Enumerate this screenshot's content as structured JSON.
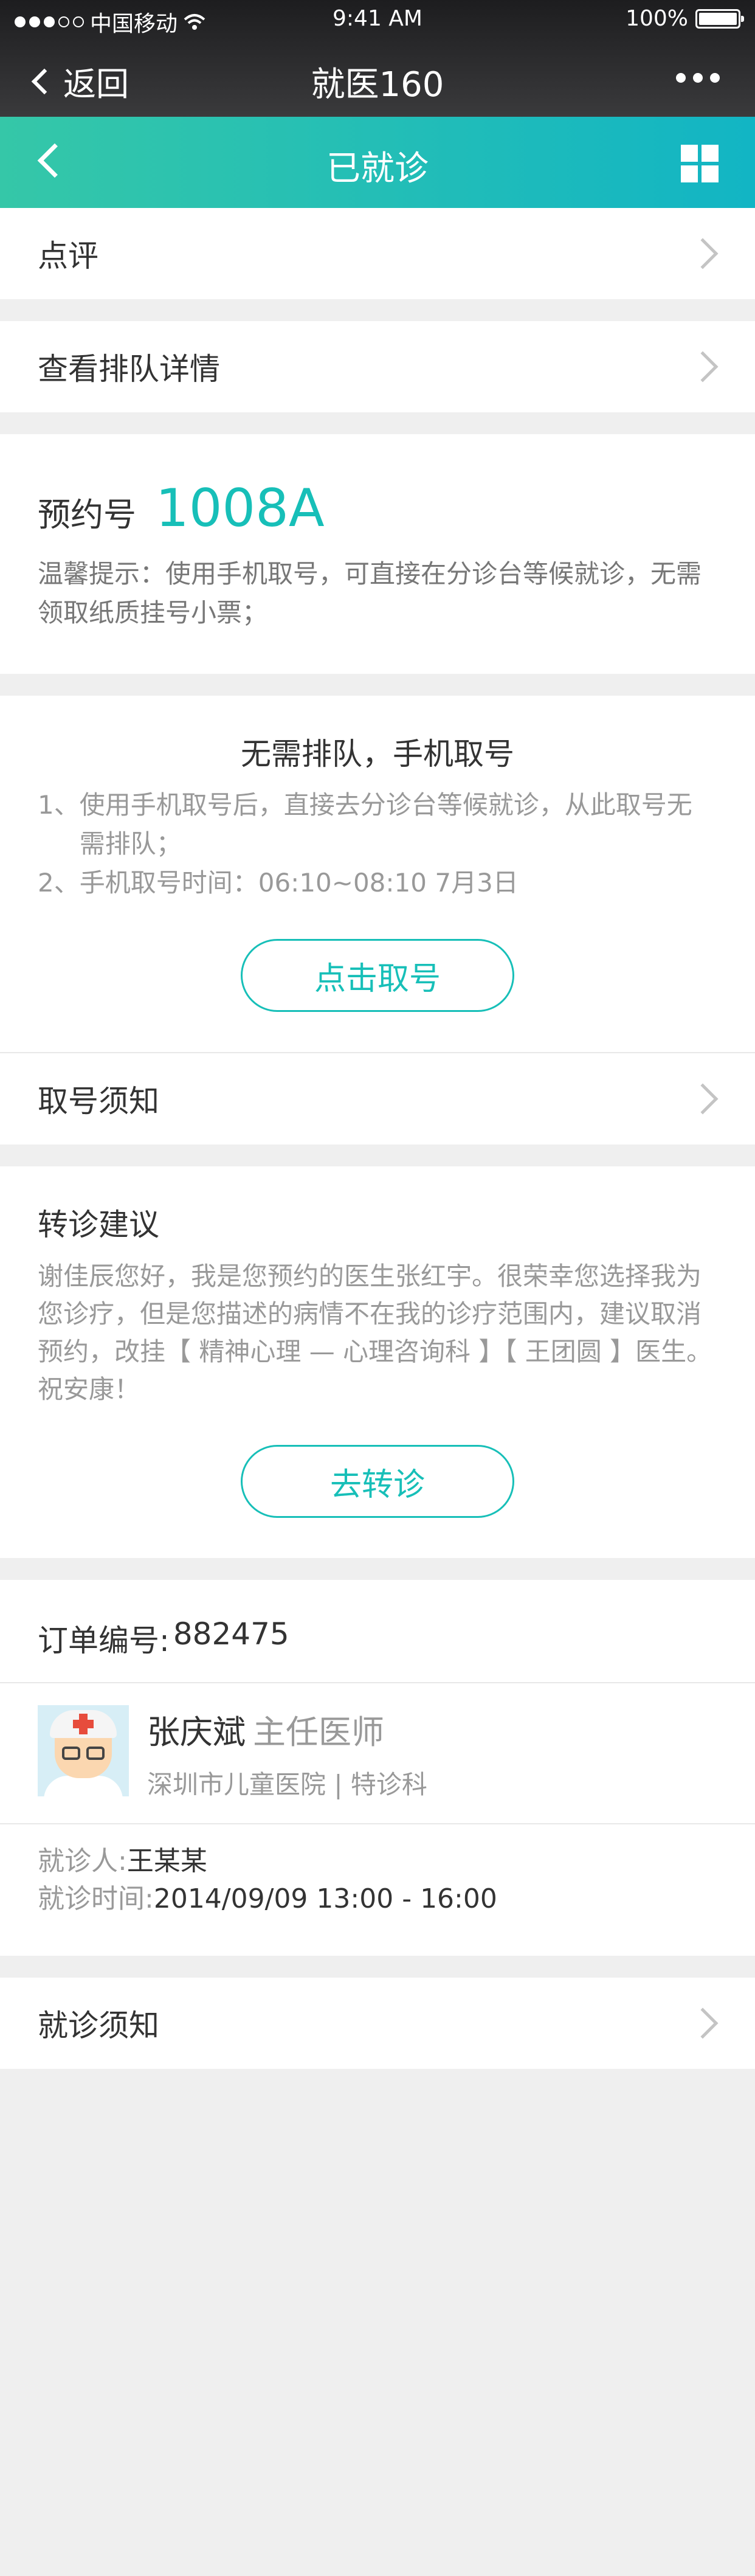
{
  "status_bar": {
    "carrier": "中国移动",
    "time": "9:41 AM",
    "battery": "100%"
  },
  "browser_nav": {
    "back_label": "返回",
    "title": "就医160"
  },
  "header": {
    "title": "已就诊"
  },
  "menu_rows": {
    "review": "点评",
    "queue_detail": "查看排队详情"
  },
  "appointment": {
    "label": "预约号",
    "number": "1008A",
    "tip": "温馨提示：使用手机取号，可直接在分诊台等候就诊，无需领取纸质挂号小票；"
  },
  "queue": {
    "title": "无需排队，手机取号",
    "items": [
      {
        "no": "1、",
        "text": "使用手机取号后，直接去分诊台等候就诊，从此取号无需排队；"
      },
      {
        "no": "2、",
        "text": "手机取号时间：06:10~08:10  7月3日"
      }
    ],
    "button": "点击取号",
    "notice": "取号须知"
  },
  "transfer": {
    "title": "转诊建议",
    "text": "谢佳辰您好，我是您预约的医生张红宇。很荣幸您选择我为您诊疗，但是您描述的病情不在我的诊疗范围内，建议取消预约，改挂【 精神心理 — 心理咨询科 】【 王团圆 】医生。祝安康！",
    "button": "去转诊"
  },
  "order": {
    "label": "订单编号:",
    "number": "882475",
    "doctor_name": "张庆斌",
    "doctor_title": "主任医师",
    "hospital": "深圳市儿童医院 | 特诊科",
    "patient_label": "就诊人:",
    "patient": "王某某",
    "time_label": "就诊时间:",
    "time": "2014/09/09  13:00 - 16:00"
  },
  "visit_notice": "就诊须知",
  "colors": {
    "accent": "#17bfb8",
    "header_gradient_start": "#35c7a8",
    "header_gradient_end": "#12b5c4"
  }
}
